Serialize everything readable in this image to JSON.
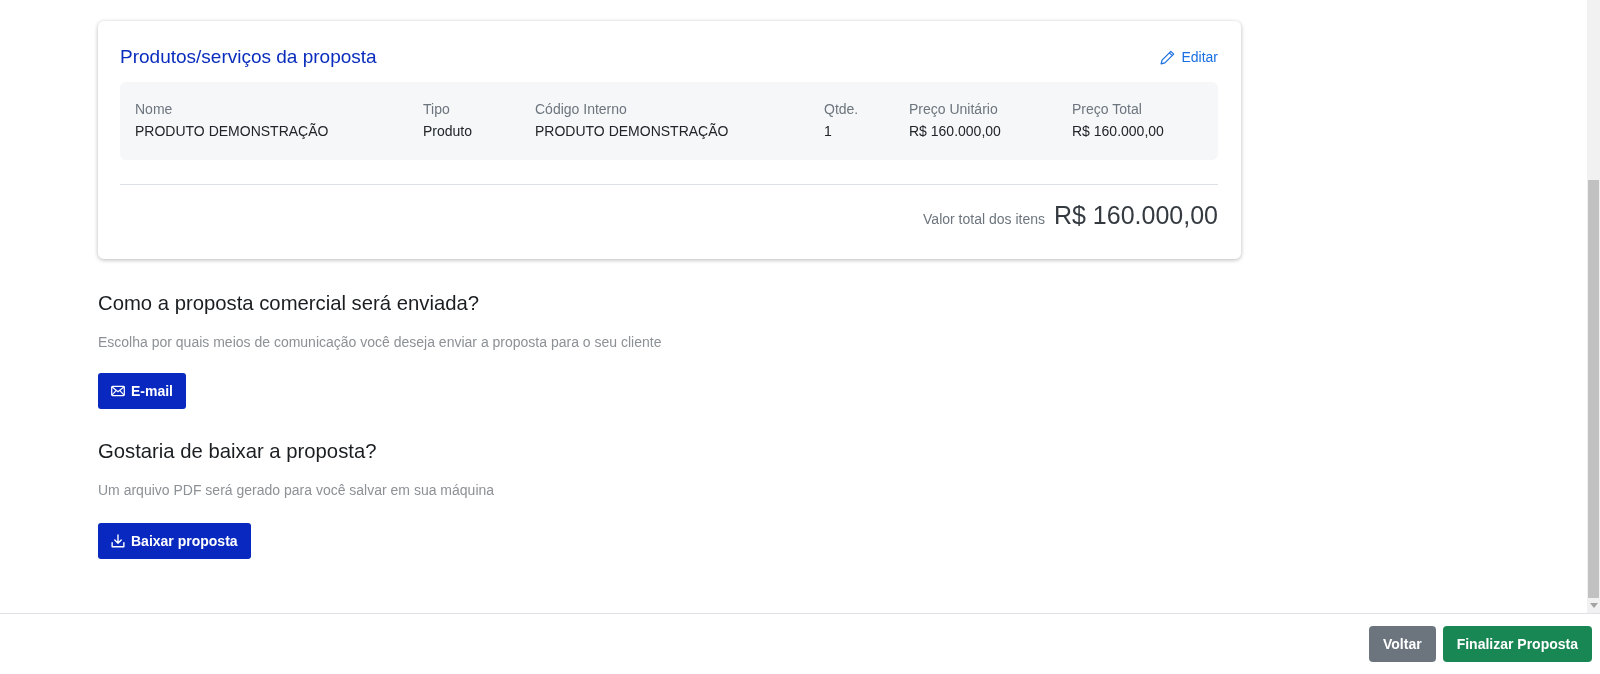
{
  "card": {
    "title": "Produtos/serviços da proposta",
    "edit_link": "Editar",
    "table": {
      "columns": [
        "Nome",
        "Tipo",
        "Código Interno",
        "Qtde.",
        "Preço Unitário",
        "Preço Total"
      ],
      "rows": [
        [
          "PRODUTO DEMONSTRAÇÃO",
          "Produto",
          "PRODUTO DEMONSTRAÇÃO",
          "1",
          "R$ 160.000,00",
          "R$ 160.000,00"
        ]
      ]
    },
    "total_label": "Valor total dos itens",
    "total_value": "R$ 160.000,00"
  },
  "sections": [
    {
      "heading": "Como a proposta comercial será enviada?",
      "description": "Escolha por quais meios de comunicação você deseja enviar a proposta para o seu cliente",
      "button": {
        "label": "E-mail",
        "kind": "send"
      }
    },
    {
      "heading": "Gostaria de baixar a proposta?",
      "description": "Um arquivo PDF será gerado para você salvar em sua máquina",
      "button": {
        "label": "Baixar proposta",
        "kind": "download"
      }
    }
  ],
  "footer": {
    "buttons": [
      {
        "label": "Voltar",
        "kind": "secondary"
      },
      {
        "label": "Finalizar Proposta",
        "kind": "primary"
      }
    ]
  }
}
